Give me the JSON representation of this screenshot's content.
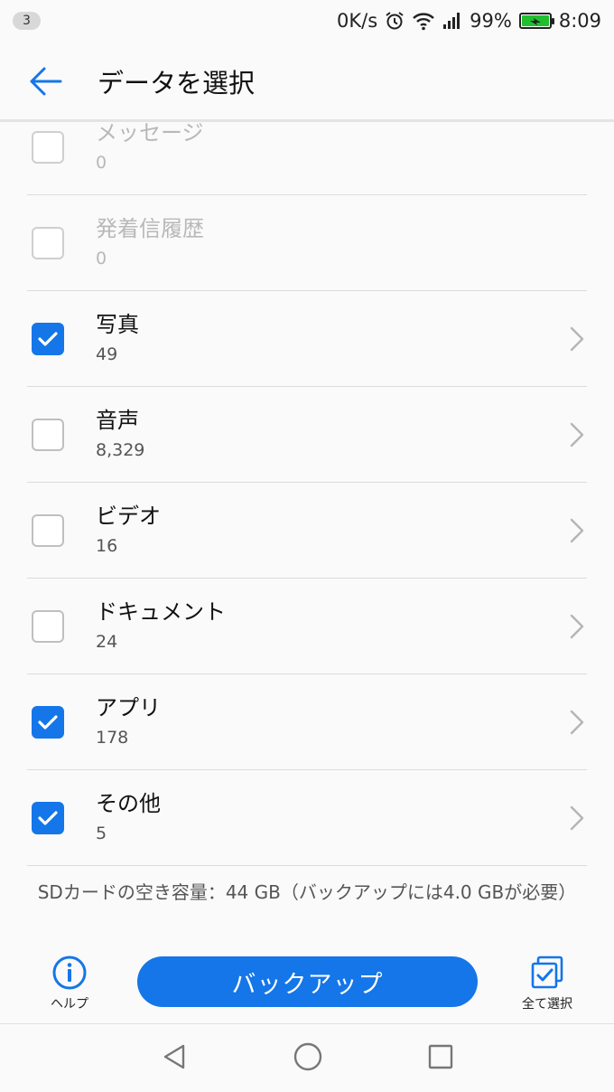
{
  "status_bar": {
    "notification_count": "3",
    "net_speed": "0K/s",
    "battery": "99%",
    "time": "8:09"
  },
  "app_bar": {
    "title": "データを選択"
  },
  "items": [
    {
      "title": "メッセージ",
      "count": "0",
      "checked": false,
      "enabled": false
    },
    {
      "title": "発着信履歴",
      "count": "0",
      "checked": false,
      "enabled": false
    },
    {
      "title": "写真",
      "count": "49",
      "checked": true,
      "enabled": true
    },
    {
      "title": "音声",
      "count": "8,329",
      "checked": false,
      "enabled": true
    },
    {
      "title": "ビデオ",
      "count": "16",
      "checked": false,
      "enabled": true
    },
    {
      "title": "ドキュメント",
      "count": "24",
      "checked": false,
      "enabled": true
    },
    {
      "title": "アプリ",
      "count": "178",
      "checked": true,
      "enabled": true
    },
    {
      "title": "その他",
      "count": "5",
      "checked": true,
      "enabled": true
    }
  ],
  "storage_info": "SDカードの空き容量：44 GB（バックアップには4.0 GBが必要）",
  "actions": {
    "help_label": "ヘルプ",
    "backup_label": "バックアップ",
    "select_all_label": "全て選択"
  },
  "colors": {
    "accent": "#1476e8"
  }
}
